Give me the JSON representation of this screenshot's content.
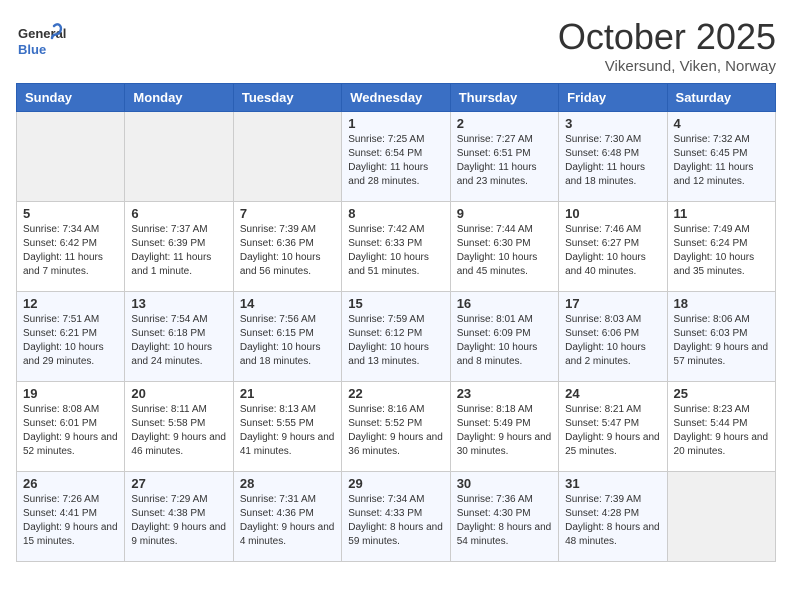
{
  "header": {
    "logo_text_general": "General",
    "logo_text_blue": "Blue",
    "month_title": "October 2025",
    "location": "Vikersund, Viken, Norway"
  },
  "days_of_week": [
    "Sunday",
    "Monday",
    "Tuesday",
    "Wednesday",
    "Thursday",
    "Friday",
    "Saturday"
  ],
  "weeks": [
    [
      {
        "day": "",
        "sunrise": "",
        "sunset": "",
        "daylight": "",
        "empty": true
      },
      {
        "day": "",
        "sunrise": "",
        "sunset": "",
        "daylight": "",
        "empty": true
      },
      {
        "day": "",
        "sunrise": "",
        "sunset": "",
        "daylight": "",
        "empty": true
      },
      {
        "day": "1",
        "sunrise": "Sunrise: 7:25 AM",
        "sunset": "Sunset: 6:54 PM",
        "daylight": "Daylight: 11 hours and 28 minutes."
      },
      {
        "day": "2",
        "sunrise": "Sunrise: 7:27 AM",
        "sunset": "Sunset: 6:51 PM",
        "daylight": "Daylight: 11 hours and 23 minutes."
      },
      {
        "day": "3",
        "sunrise": "Sunrise: 7:30 AM",
        "sunset": "Sunset: 6:48 PM",
        "daylight": "Daylight: 11 hours and 18 minutes."
      },
      {
        "day": "4",
        "sunrise": "Sunrise: 7:32 AM",
        "sunset": "Sunset: 6:45 PM",
        "daylight": "Daylight: 11 hours and 12 minutes."
      }
    ],
    [
      {
        "day": "5",
        "sunrise": "Sunrise: 7:34 AM",
        "sunset": "Sunset: 6:42 PM",
        "daylight": "Daylight: 11 hours and 7 minutes."
      },
      {
        "day": "6",
        "sunrise": "Sunrise: 7:37 AM",
        "sunset": "Sunset: 6:39 PM",
        "daylight": "Daylight: 11 hours and 1 minute."
      },
      {
        "day": "7",
        "sunrise": "Sunrise: 7:39 AM",
        "sunset": "Sunset: 6:36 PM",
        "daylight": "Daylight: 10 hours and 56 minutes."
      },
      {
        "day": "8",
        "sunrise": "Sunrise: 7:42 AM",
        "sunset": "Sunset: 6:33 PM",
        "daylight": "Daylight: 10 hours and 51 minutes."
      },
      {
        "day": "9",
        "sunrise": "Sunrise: 7:44 AM",
        "sunset": "Sunset: 6:30 PM",
        "daylight": "Daylight: 10 hours and 45 minutes."
      },
      {
        "day": "10",
        "sunrise": "Sunrise: 7:46 AM",
        "sunset": "Sunset: 6:27 PM",
        "daylight": "Daylight: 10 hours and 40 minutes."
      },
      {
        "day": "11",
        "sunrise": "Sunrise: 7:49 AM",
        "sunset": "Sunset: 6:24 PM",
        "daylight": "Daylight: 10 hours and 35 minutes."
      }
    ],
    [
      {
        "day": "12",
        "sunrise": "Sunrise: 7:51 AM",
        "sunset": "Sunset: 6:21 PM",
        "daylight": "Daylight: 10 hours and 29 minutes."
      },
      {
        "day": "13",
        "sunrise": "Sunrise: 7:54 AM",
        "sunset": "Sunset: 6:18 PM",
        "daylight": "Daylight: 10 hours and 24 minutes."
      },
      {
        "day": "14",
        "sunrise": "Sunrise: 7:56 AM",
        "sunset": "Sunset: 6:15 PM",
        "daylight": "Daylight: 10 hours and 18 minutes."
      },
      {
        "day": "15",
        "sunrise": "Sunrise: 7:59 AM",
        "sunset": "Sunset: 6:12 PM",
        "daylight": "Daylight: 10 hours and 13 minutes."
      },
      {
        "day": "16",
        "sunrise": "Sunrise: 8:01 AM",
        "sunset": "Sunset: 6:09 PM",
        "daylight": "Daylight: 10 hours and 8 minutes."
      },
      {
        "day": "17",
        "sunrise": "Sunrise: 8:03 AM",
        "sunset": "Sunset: 6:06 PM",
        "daylight": "Daylight: 10 hours and 2 minutes."
      },
      {
        "day": "18",
        "sunrise": "Sunrise: 8:06 AM",
        "sunset": "Sunset: 6:03 PM",
        "daylight": "Daylight: 9 hours and 57 minutes."
      }
    ],
    [
      {
        "day": "19",
        "sunrise": "Sunrise: 8:08 AM",
        "sunset": "Sunset: 6:01 PM",
        "daylight": "Daylight: 9 hours and 52 minutes."
      },
      {
        "day": "20",
        "sunrise": "Sunrise: 8:11 AM",
        "sunset": "Sunset: 5:58 PM",
        "daylight": "Daylight: 9 hours and 46 minutes."
      },
      {
        "day": "21",
        "sunrise": "Sunrise: 8:13 AM",
        "sunset": "Sunset: 5:55 PM",
        "daylight": "Daylight: 9 hours and 41 minutes."
      },
      {
        "day": "22",
        "sunrise": "Sunrise: 8:16 AM",
        "sunset": "Sunset: 5:52 PM",
        "daylight": "Daylight: 9 hours and 36 minutes."
      },
      {
        "day": "23",
        "sunrise": "Sunrise: 8:18 AM",
        "sunset": "Sunset: 5:49 PM",
        "daylight": "Daylight: 9 hours and 30 minutes."
      },
      {
        "day": "24",
        "sunrise": "Sunrise: 8:21 AM",
        "sunset": "Sunset: 5:47 PM",
        "daylight": "Daylight: 9 hours and 25 minutes."
      },
      {
        "day": "25",
        "sunrise": "Sunrise: 8:23 AM",
        "sunset": "Sunset: 5:44 PM",
        "daylight": "Daylight: 9 hours and 20 minutes."
      }
    ],
    [
      {
        "day": "26",
        "sunrise": "Sunrise: 7:26 AM",
        "sunset": "Sunset: 4:41 PM",
        "daylight": "Daylight: 9 hours and 15 minutes."
      },
      {
        "day": "27",
        "sunrise": "Sunrise: 7:29 AM",
        "sunset": "Sunset: 4:38 PM",
        "daylight": "Daylight: 9 hours and 9 minutes."
      },
      {
        "day": "28",
        "sunrise": "Sunrise: 7:31 AM",
        "sunset": "Sunset: 4:36 PM",
        "daylight": "Daylight: 9 hours and 4 minutes."
      },
      {
        "day": "29",
        "sunrise": "Sunrise: 7:34 AM",
        "sunset": "Sunset: 4:33 PM",
        "daylight": "Daylight: 8 hours and 59 minutes."
      },
      {
        "day": "30",
        "sunrise": "Sunrise: 7:36 AM",
        "sunset": "Sunset: 4:30 PM",
        "daylight": "Daylight: 8 hours and 54 minutes."
      },
      {
        "day": "31",
        "sunrise": "Sunrise: 7:39 AM",
        "sunset": "Sunset: 4:28 PM",
        "daylight": "Daylight: 8 hours and 48 minutes."
      },
      {
        "day": "",
        "sunrise": "",
        "sunset": "",
        "daylight": "",
        "empty": true
      }
    ]
  ]
}
